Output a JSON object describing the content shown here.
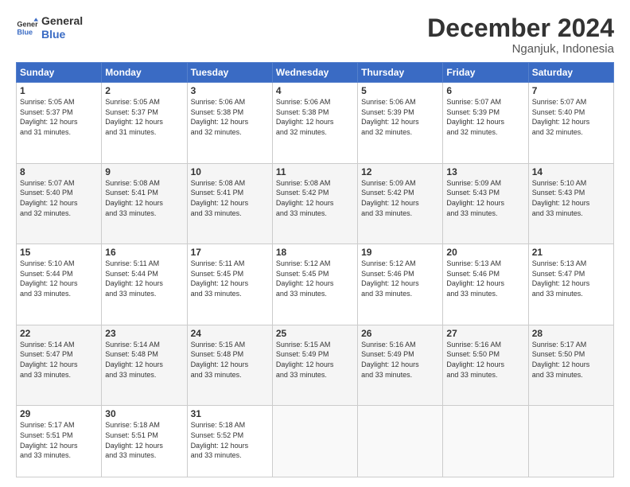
{
  "header": {
    "logo_line1": "General",
    "logo_line2": "Blue",
    "month": "December 2024",
    "location": "Nganjuk, Indonesia"
  },
  "days_of_week": [
    "Sunday",
    "Monday",
    "Tuesday",
    "Wednesday",
    "Thursday",
    "Friday",
    "Saturday"
  ],
  "weeks": [
    [
      {
        "day": "1",
        "info": "Sunrise: 5:05 AM\nSunset: 5:37 PM\nDaylight: 12 hours\nand 31 minutes."
      },
      {
        "day": "2",
        "info": "Sunrise: 5:05 AM\nSunset: 5:37 PM\nDaylight: 12 hours\nand 31 minutes."
      },
      {
        "day": "3",
        "info": "Sunrise: 5:06 AM\nSunset: 5:38 PM\nDaylight: 12 hours\nand 32 minutes."
      },
      {
        "day": "4",
        "info": "Sunrise: 5:06 AM\nSunset: 5:38 PM\nDaylight: 12 hours\nand 32 minutes."
      },
      {
        "day": "5",
        "info": "Sunrise: 5:06 AM\nSunset: 5:39 PM\nDaylight: 12 hours\nand 32 minutes."
      },
      {
        "day": "6",
        "info": "Sunrise: 5:07 AM\nSunset: 5:39 PM\nDaylight: 12 hours\nand 32 minutes."
      },
      {
        "day": "7",
        "info": "Sunrise: 5:07 AM\nSunset: 5:40 PM\nDaylight: 12 hours\nand 32 minutes."
      }
    ],
    [
      {
        "day": "8",
        "info": "Sunrise: 5:07 AM\nSunset: 5:40 PM\nDaylight: 12 hours\nand 32 minutes."
      },
      {
        "day": "9",
        "info": "Sunrise: 5:08 AM\nSunset: 5:41 PM\nDaylight: 12 hours\nand 33 minutes."
      },
      {
        "day": "10",
        "info": "Sunrise: 5:08 AM\nSunset: 5:41 PM\nDaylight: 12 hours\nand 33 minutes."
      },
      {
        "day": "11",
        "info": "Sunrise: 5:08 AM\nSunset: 5:42 PM\nDaylight: 12 hours\nand 33 minutes."
      },
      {
        "day": "12",
        "info": "Sunrise: 5:09 AM\nSunset: 5:42 PM\nDaylight: 12 hours\nand 33 minutes."
      },
      {
        "day": "13",
        "info": "Sunrise: 5:09 AM\nSunset: 5:43 PM\nDaylight: 12 hours\nand 33 minutes."
      },
      {
        "day": "14",
        "info": "Sunrise: 5:10 AM\nSunset: 5:43 PM\nDaylight: 12 hours\nand 33 minutes."
      }
    ],
    [
      {
        "day": "15",
        "info": "Sunrise: 5:10 AM\nSunset: 5:44 PM\nDaylight: 12 hours\nand 33 minutes."
      },
      {
        "day": "16",
        "info": "Sunrise: 5:11 AM\nSunset: 5:44 PM\nDaylight: 12 hours\nand 33 minutes."
      },
      {
        "day": "17",
        "info": "Sunrise: 5:11 AM\nSunset: 5:45 PM\nDaylight: 12 hours\nand 33 minutes."
      },
      {
        "day": "18",
        "info": "Sunrise: 5:12 AM\nSunset: 5:45 PM\nDaylight: 12 hours\nand 33 minutes."
      },
      {
        "day": "19",
        "info": "Sunrise: 5:12 AM\nSunset: 5:46 PM\nDaylight: 12 hours\nand 33 minutes."
      },
      {
        "day": "20",
        "info": "Sunrise: 5:13 AM\nSunset: 5:46 PM\nDaylight: 12 hours\nand 33 minutes."
      },
      {
        "day": "21",
        "info": "Sunrise: 5:13 AM\nSunset: 5:47 PM\nDaylight: 12 hours\nand 33 minutes."
      }
    ],
    [
      {
        "day": "22",
        "info": "Sunrise: 5:14 AM\nSunset: 5:47 PM\nDaylight: 12 hours\nand 33 minutes."
      },
      {
        "day": "23",
        "info": "Sunrise: 5:14 AM\nSunset: 5:48 PM\nDaylight: 12 hours\nand 33 minutes."
      },
      {
        "day": "24",
        "info": "Sunrise: 5:15 AM\nSunset: 5:48 PM\nDaylight: 12 hours\nand 33 minutes."
      },
      {
        "day": "25",
        "info": "Sunrise: 5:15 AM\nSunset: 5:49 PM\nDaylight: 12 hours\nand 33 minutes."
      },
      {
        "day": "26",
        "info": "Sunrise: 5:16 AM\nSunset: 5:49 PM\nDaylight: 12 hours\nand 33 minutes."
      },
      {
        "day": "27",
        "info": "Sunrise: 5:16 AM\nSunset: 5:50 PM\nDaylight: 12 hours\nand 33 minutes."
      },
      {
        "day": "28",
        "info": "Sunrise: 5:17 AM\nSunset: 5:50 PM\nDaylight: 12 hours\nand 33 minutes."
      }
    ],
    [
      {
        "day": "29",
        "info": "Sunrise: 5:17 AM\nSunset: 5:51 PM\nDaylight: 12 hours\nand 33 minutes."
      },
      {
        "day": "30",
        "info": "Sunrise: 5:18 AM\nSunset: 5:51 PM\nDaylight: 12 hours\nand 33 minutes."
      },
      {
        "day": "31",
        "info": "Sunrise: 5:18 AM\nSunset: 5:52 PM\nDaylight: 12 hours\nand 33 minutes."
      },
      {
        "day": "",
        "info": ""
      },
      {
        "day": "",
        "info": ""
      },
      {
        "day": "",
        "info": ""
      },
      {
        "day": "",
        "info": ""
      }
    ]
  ]
}
